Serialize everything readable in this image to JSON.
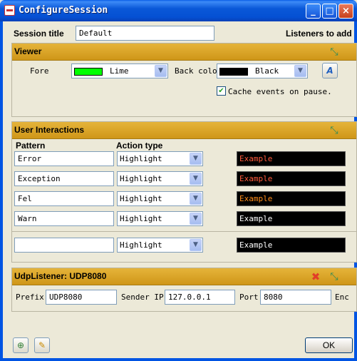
{
  "window": {
    "title": "ConfigureSession",
    "min_symbol": "_",
    "max_symbol": "□",
    "close_symbol": "×"
  },
  "session": {
    "title_label": "Session title",
    "title_value": "Default",
    "listeners_label": "Listeners to add"
  },
  "viewer": {
    "header": "Viewer",
    "fore_label": "Fore",
    "fore_value": "Lime",
    "fore_color": "#00ff00",
    "back_label": "Back color",
    "back_value": "Black",
    "back_color": "#000000",
    "font_button_glyph": "A",
    "cache_label": "Cache events on pause.",
    "cache_checked": true
  },
  "interactions": {
    "header": "User Interactions",
    "pattern_label": "Pattern",
    "action_label": "Action type",
    "rows": [
      {
        "pattern": "Error",
        "action": "Highlight",
        "example": "Example",
        "color": "#ff5a3c"
      },
      {
        "pattern": "Exception",
        "action": "Highlight",
        "example": "Example",
        "color": "#ff5a3c"
      },
      {
        "pattern": "Fel",
        "action": "Highlight",
        "example": "Example",
        "color": "#ff8c1a"
      },
      {
        "pattern": "Warn",
        "action": "Highlight",
        "example": "Example",
        "color": "#ffffff"
      }
    ],
    "new_row": {
      "pattern": "",
      "action": "Highlight",
      "example": "Example",
      "color": "#ffffff"
    }
  },
  "udp": {
    "header": "UdpListener: UDP8080",
    "prefix_label": "Prefix",
    "prefix_value": "UDP8080",
    "sender_label": "Sender IP",
    "sender_value": "127.0.0.1",
    "port_label": "Port",
    "port_value": "8080",
    "enc_label": "Enc"
  },
  "footer": {
    "ok_label": "OK"
  },
  "colors": {
    "section_header": "#d9a325",
    "window_blue": "#0054e3",
    "dialog_bg": "#ece9d8"
  },
  "icons": {
    "collapse": "collapse-icon",
    "remove": "remove-icon",
    "font": "font-icon",
    "add_listener": "add-listener-icon",
    "open_config": "open-config-icon"
  }
}
